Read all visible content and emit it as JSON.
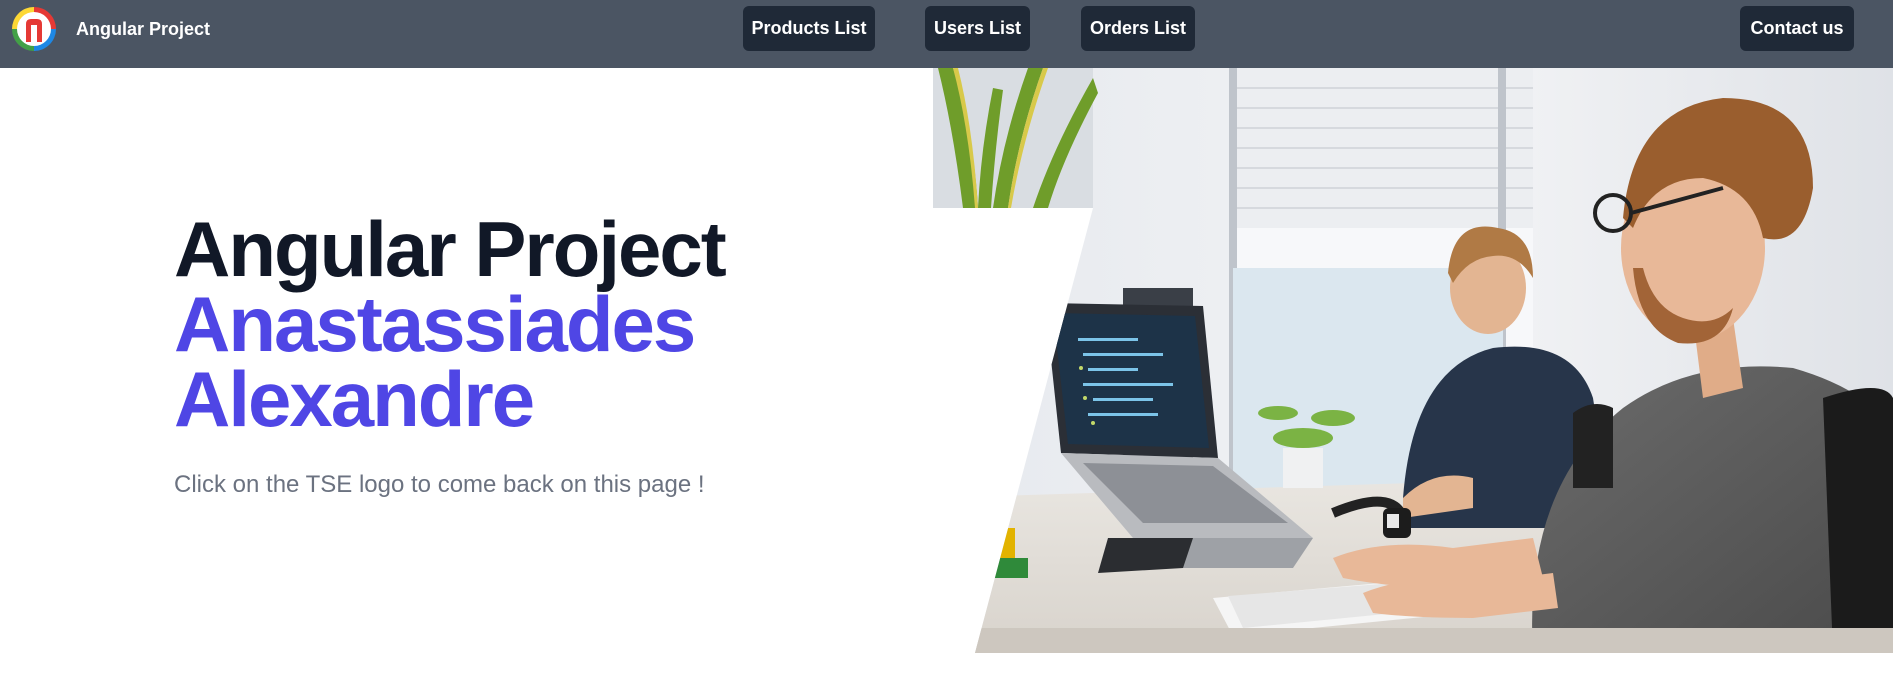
{
  "navbar": {
    "brand_name": "Angular Project",
    "logo_icon": "tse-logo-icon",
    "links": [
      {
        "label": "Products List"
      },
      {
        "label": "Users List"
      },
      {
        "label": "Orders List"
      }
    ],
    "contact_label": "Contact us",
    "background": "#4b5563",
    "button_color": "#1f2937"
  },
  "hero": {
    "title_line1": "Angular Project",
    "title_line2": "Anastassiades",
    "title_line3": "Alexandre",
    "subtitle": "Click on the TSE logo to come back on this page !",
    "title_color": "#111827",
    "accent_color": "#4f46e5",
    "image_icon": "office-developers-photo"
  }
}
